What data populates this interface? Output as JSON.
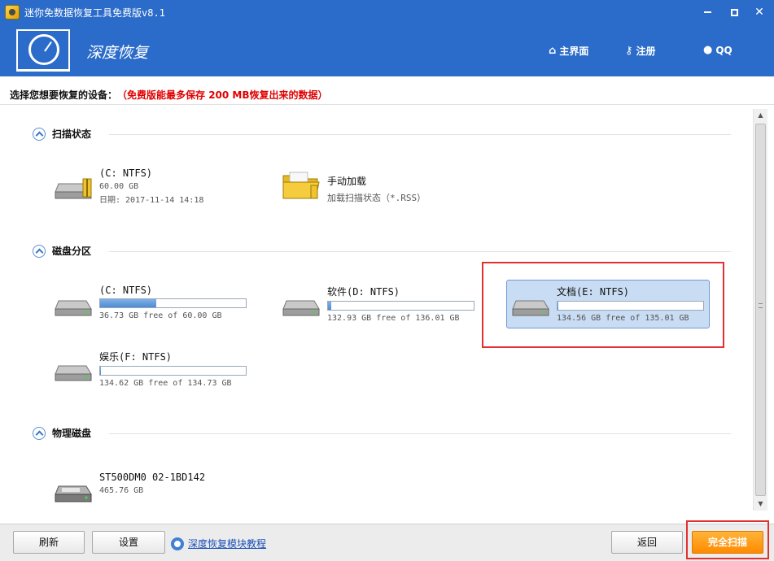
{
  "window": {
    "title": "迷你免数据恢复工具免费版v8.1"
  },
  "header": {
    "brand": "深度恢复",
    "nav": [
      {
        "label": "主界面",
        "icon": "home-icon"
      },
      {
        "label": "注册",
        "icon": "key-icon"
      },
      {
        "label": "QQ",
        "icon": "qq-penguin-icon"
      }
    ]
  },
  "prompt": {
    "text": "选择您想要恢复的设备：",
    "warning": "（免费版能最多保存 200 MB恢复出来的数据）"
  },
  "sections": {
    "scan_status": {
      "title": "扫描状态",
      "items": [
        {
          "name": "(C: NTFS)",
          "size": "60.00 GB",
          "date": "日期: 2017-11-14 14:18"
        },
        {
          "name": "手动加载",
          "sub": "加载扫描状态（*.RSS）"
        }
      ]
    },
    "partitions": {
      "title": "磁盘分区",
      "items": [
        {
          "name": "(C: NTFS)",
          "free": "36.73 GB free of 60.00 GB",
          "used_fraction": 0.388
        },
        {
          "name": "软件(D: NTFS)",
          "free": "132.93 GB free of 136.01 GB",
          "used_fraction": 0.023
        },
        {
          "name": "文档(E: NTFS)",
          "free": "134.56 GB free of 135.01 GB",
          "used_fraction": 0.003
        },
        {
          "name": "娱乐(F: NTFS)",
          "free": "134.62 GB free of 134.73 GB",
          "used_fraction": 0.001
        }
      ]
    },
    "physical": {
      "title": "物理磁盘",
      "items": [
        {
          "name": "ST500DM0 02-1BD142",
          "size": "465.76 GB"
        }
      ]
    }
  },
  "footer": {
    "refresh": "刷新",
    "settings": "设置",
    "tutorial": "深度恢复模块教程",
    "back": "返回",
    "full_scan": "完全扫描"
  },
  "colors": {
    "header_bg": "#2b6bc9",
    "warning": "#e00000",
    "highlight": "#e23030",
    "scan_button": "#ff8a00",
    "selected_bg": "#c8dcf4"
  }
}
